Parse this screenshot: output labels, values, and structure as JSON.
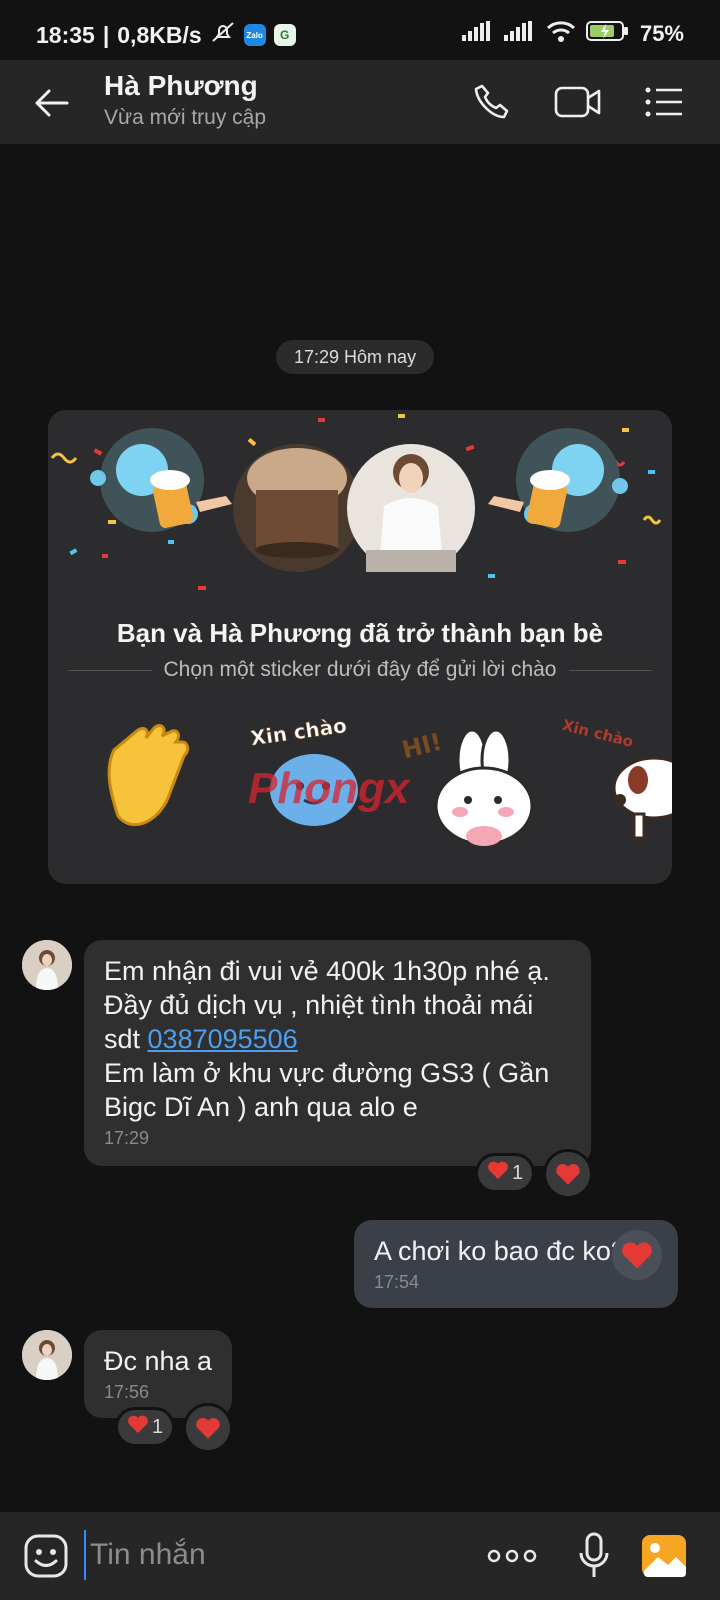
{
  "status_bar": {
    "time": "18:35",
    "separator": "|",
    "speed": "0,8KB/s",
    "battery": "75%",
    "app_badge_zalo": "Zalo",
    "app_badge_other": "G"
  },
  "header": {
    "contact_name": "Hà Phương",
    "contact_status": "Vừa mới truy cập"
  },
  "chat": {
    "date_divider": "17:29 Hôm nay",
    "friend_card": {
      "title": "Bạn và Hà Phương đã trở thành bạn bè",
      "subtitle": "Chọn một sticker dưới đây để gửi lời chào",
      "sticker_text_1": "Xin chào",
      "sticker_text_2": "HI!",
      "sticker_text_3": "Xin chào",
      "watermark": "Phongx"
    },
    "messages": [
      {
        "direction": "in",
        "line1": "Em nhận đi vui vẻ 400k 1h30p nhé ạ.",
        "line2": "Đầy đủ dịch vụ , nhiệt tình thoải mái",
        "line3_prefix": "sdt ",
        "phone_link": "0387095506",
        "line4": "Em làm ở khu vực đường GS3 ( Gần",
        "line5": "Bigc Dĩ An ) anh qua alo e",
        "time": "17:29",
        "reaction_count": "1"
      },
      {
        "direction": "out",
        "text": "A chơi ko bao đc ko?",
        "time": "17:54"
      },
      {
        "direction": "in",
        "text": "Đc nha a",
        "time": "17:56",
        "reaction_count": "1"
      }
    ]
  },
  "input": {
    "placeholder": "Tin nhắn"
  },
  "colors": {
    "background": "#121212",
    "header": "#262626",
    "incoming_bubble": "#2f2f30",
    "outgoing_bubble": "#3a3f48",
    "link": "#4a9ff0",
    "heart": "#e53935",
    "accent_gallery": "#f5a623"
  }
}
